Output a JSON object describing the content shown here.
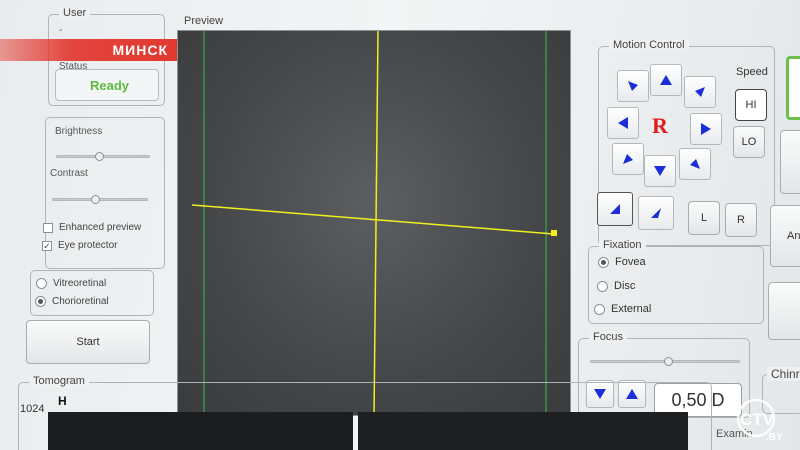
{
  "overlay": {
    "city": "МИНСК",
    "logo_main": "CTV",
    "logo_sub": ".BY"
  },
  "user_group": {
    "title": "User",
    "value": "-",
    "status_label": "Status",
    "status_value": "Ready",
    "status_color": "#5dbb3c"
  },
  "image_settings": {
    "brightness_label": "Brightness",
    "brightness_level": 0.5,
    "contrast_label": "Contrast",
    "contrast_level": 0.45,
    "enhanced_preview_label": "Enhanced preview",
    "enhanced_preview_checked": false,
    "eye_protector_label": "Eye protector",
    "eye_protector_checked": true
  },
  "mode": {
    "options": [
      "Vitreoretinal",
      "Chorioretinal"
    ],
    "selected": "Chorioretinal"
  },
  "start_button": "Start",
  "preview": {
    "title": "Preview",
    "crosshair_color": "#f2ef1e",
    "guide_color": "#3ba84a"
  },
  "motion_control": {
    "title": "Motion Control",
    "center_label": "R",
    "speed_label": "Speed",
    "speed_hi": "HI",
    "speed_lo": "LO",
    "left_button": "L",
    "right_button": "R",
    "arrow_color": "#1a2fd6"
  },
  "fixation": {
    "title": "Fixation",
    "options": [
      "Fovea",
      "Disc",
      "External"
    ],
    "selected": "Fovea"
  },
  "focus": {
    "title": "Focus",
    "value": "0,50 D",
    "slider_level": 0.58
  },
  "tomogram": {
    "title": "Tomogram",
    "axis_top": "1024",
    "orientation": "H"
  },
  "right_panel": {
    "partial_button": "An",
    "chinrest_label": "Chinre",
    "exam_label": "Examin"
  }
}
